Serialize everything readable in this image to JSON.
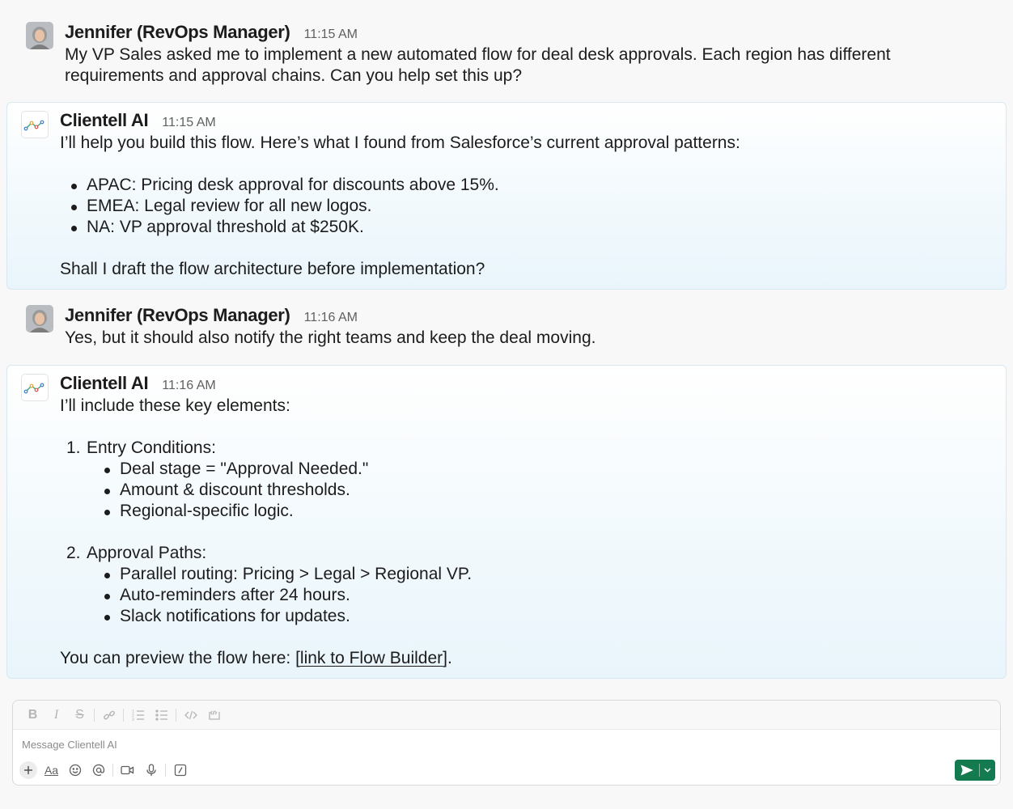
{
  "messages": [
    {
      "author": "Jennifer (RevOps Manager)",
      "time": "11:15 AM",
      "text": "My VP Sales asked me to implement a new automated flow for deal desk approvals. Each region has different requirements and approval chains. Can you help set this up?"
    },
    {
      "author": "Clientell AI",
      "time": "11:15 AM",
      "intro": "I’ll help you build this flow. Here’s what I found from Salesforce’s current approval patterns:",
      "bullets": [
        "APAC: Pricing desk approval for discounts above 15%.",
        "EMEA: Legal review for all new logos.",
        "NA: VP approval threshold at $250K."
      ],
      "outro": "Shall I draft the flow architecture before implementation?"
    },
    {
      "author": "Jennifer (RevOps Manager)",
      "time": "11:16 AM",
      "text": "Yes, but it should also notify the right teams and keep the deal moving."
    },
    {
      "author": "Clientell AI",
      "time": "11:16 AM",
      "intro": "I’ll include these key elements:",
      "sections": [
        {
          "number": "1.",
          "title": "Entry Conditions:",
          "items": [
            "Deal stage = \"Approval Needed.\"",
            "Amount & discount thresholds.",
            "Regional-specific logic."
          ]
        },
        {
          "number": "2.",
          "title": "Approval Paths:",
          "items": [
            "Parallel routing: Pricing > Legal > Regional VP.",
            "Auto-reminders after 24 hours.",
            "Slack notifications for updates."
          ]
        }
      ],
      "outro_prefix": "You can preview the flow here: [",
      "link_text": "link to Flow Builder",
      "outro_suffix": "]."
    }
  ],
  "composer": {
    "placeholder": "Message Clientell AI",
    "format_label": "Aa",
    "toolbar_icons": [
      "bold-icon",
      "italic-icon",
      "strikethrough-icon",
      "link-icon",
      "ordered-list-icon",
      "bulleted-list-icon",
      "code-icon",
      "code-block-icon"
    ],
    "action_icons": [
      "plus-icon",
      "formatting-icon",
      "emoji-icon",
      "mention-icon",
      "video-icon",
      "microphone-icon",
      "slash-command-icon",
      "send-icon",
      "chevron-down-icon"
    ]
  },
  "colors": {
    "send_button": "#147a4f",
    "ai_message_tint": "#e9f5fb"
  }
}
